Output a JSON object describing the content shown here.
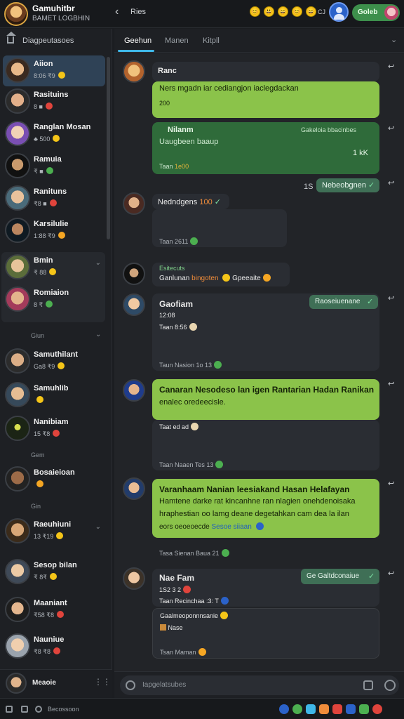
{
  "topbar": {
    "title": "Gamuhitbr",
    "subtitle": "BAMET LOGBHIN",
    "back_glyph": "‹",
    "label": "Ries",
    "counter": "CJ",
    "status": "Goleb",
    "emoji_row": [
      "😊",
      "😃",
      "😄",
      "😊",
      "😄"
    ]
  },
  "sidebar": {
    "header": "Diagpeutasoes",
    "contacts": [
      {
        "name": "Aiion",
        "meta": "8:06 ₹9",
        "badge_color": "#f5c518",
        "active": true
      },
      {
        "name": "Rasituins",
        "meta": "8 ■",
        "badge_color": "#e0443c"
      },
      {
        "name": "Ranglan Mosan",
        "meta": "♣ 500",
        "badge_color": "#f5c518"
      },
      {
        "name": "Ramuia",
        "meta": "₹ ■",
        "badge_color": "#4caf50"
      },
      {
        "name": "Ranituns",
        "meta": "₹8 ■",
        "badge_color": "#e0443c"
      },
      {
        "name": "Karsilulie",
        "meta": "1:88 ₹9",
        "badge_color": "#f5a623"
      },
      {
        "name": "Bmin",
        "meta": "₹ 88",
        "badge_color": "#f5c518",
        "chev": "⌄"
      },
      {
        "name": "Romiaion",
        "meta": "8 ₹",
        "badge_color": "#4caf50"
      },
      {
        "name": "Samuthilant",
        "meta": "Ga8 ₹9",
        "badge_color": "#f5c518"
      },
      {
        "name": "Samuhlib",
        "meta": "",
        "badge_color": "#f5c518"
      },
      {
        "name": "Nanibiam",
        "meta": "15 ₹8",
        "badge_color": "#e0443c"
      },
      {
        "name": "Bosaieioan",
        "meta": "",
        "badge_color": "#f5a623"
      },
      {
        "name": "Raeuhiuni",
        "meta": "13 ₹19",
        "badge_color": "#f5c518",
        "chev": "⌄"
      },
      {
        "name": "Sesop bilan",
        "meta": "₹ 8₹",
        "badge_color": "#f5c518"
      },
      {
        "name": "Maaniant",
        "meta": "₹58 ₹8",
        "badge_color": "#e0443c"
      },
      {
        "name": "Nauniue",
        "meta": "₹8 ₹8",
        "badge_color": "#e0443c"
      }
    ],
    "dividers": [
      {
        "label": "Giun",
        "chev": "⌄"
      },
      {
        "label": "Gem"
      },
      {
        "label": "Gin"
      }
    ],
    "footer_name": "Meaoie",
    "footer_more": "⋮⋮"
  },
  "tabs": {
    "items": [
      "Geehun",
      "Manen",
      "Kitpll"
    ],
    "active": 0,
    "chev": "⌄"
  },
  "messages": {
    "m1": {
      "header": "Ranc",
      "text": "Ners mgadn iar cediangjon iaclegdackan",
      "time": "200"
    },
    "m2": {
      "header": "Nilanm",
      "right": "Gakeloia bbacinbes",
      "text": "Uaugbeen baaup",
      "counter": "1 kK",
      "time": "Taan",
      "time2": "1e00"
    },
    "m3": {
      "count": "1S",
      "text": "Nebeobgnen",
      "tick": "✓"
    },
    "m4": {
      "text": "Nedndgens",
      "num": "100",
      "time": "Taan 2611"
    },
    "m5": {
      "header": "Esitecuts",
      "text_a": "Ganlunan",
      "text_b": "bingoten",
      "text_c": "Gpeeaite"
    },
    "m6": {
      "header": "Gaofiam",
      "time_a": "12:08",
      "time_b": "Taan  8:56",
      "reply": "Raoseiuenane",
      "time": "Taun  Nasion  1o  13"
    },
    "m7": {
      "text_1": "Canaran Nesodeso lan igen Rantarian Hadan Ranikan",
      "text_2": "enalec oredeecisle.",
      "time_a": "Taat  ed  ad",
      "time_b": "Taan  Naaen  Tes  13"
    },
    "m8": {
      "text_1": "Varanhaam Nanian leesiakand Hasan Helafayan",
      "text_2": "Hamtene darke rat kincanhne ran nlagien onehdenoisaka",
      "text_3": "hraphestian oo lamg deane degetahkan cam dea la ilan",
      "text_4": "eors oeoeoecde",
      "link": "Sesoe siiaan",
      "time": "Tasa  Sienan  Baua  21"
    },
    "m9": {
      "header": "Nae Fam",
      "time_a": "1S2 3 2",
      "time_b": "Taan  Recinchaa  :3:  T",
      "reply": "Ge Galtdconaiue",
      "quote": "Gaalmeoponnnsanie",
      "quote_label": "Nase",
      "time": "Tsan  Maman"
    }
  },
  "composer": {
    "placeholder": "Iapgelatsubes"
  },
  "bottombar": {
    "label": "Becossoon"
  }
}
